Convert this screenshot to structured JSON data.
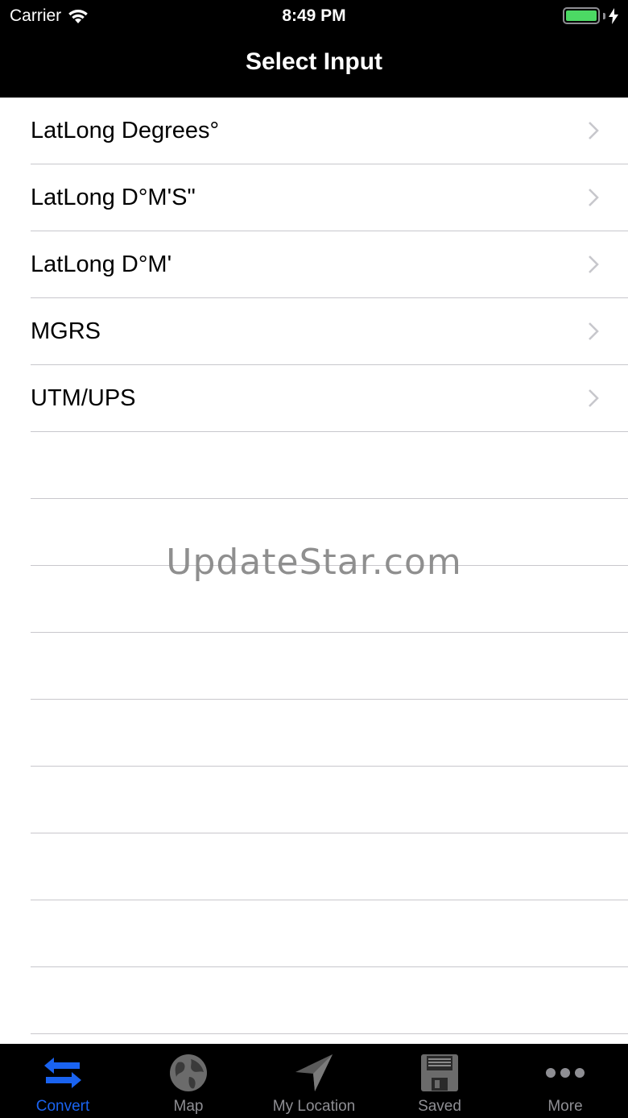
{
  "status_bar": {
    "carrier": "Carrier",
    "time": "8:49 PM",
    "battery_color": "#4cd964"
  },
  "nav": {
    "title": "Select Input"
  },
  "list": {
    "items": [
      {
        "label": "LatLong Degrees°"
      },
      {
        "label": "LatLong D°M'S\""
      },
      {
        "label": "LatLong D°M'"
      },
      {
        "label": "MGRS"
      },
      {
        "label": "UTM/UPS"
      }
    ]
  },
  "watermark": "UpdateStar.com",
  "tabbar": {
    "active_color": "#1a63f0",
    "tabs": [
      {
        "label": "Convert",
        "icon": "convert-arrows-icon",
        "active": true
      },
      {
        "label": "Map",
        "icon": "globe-icon",
        "active": false
      },
      {
        "label": "My Location",
        "icon": "location-arrow-icon",
        "active": false
      },
      {
        "label": "Saved",
        "icon": "floppy-disk-icon",
        "active": false
      },
      {
        "label": "More",
        "icon": "more-dots-icon",
        "active": false
      }
    ]
  }
}
